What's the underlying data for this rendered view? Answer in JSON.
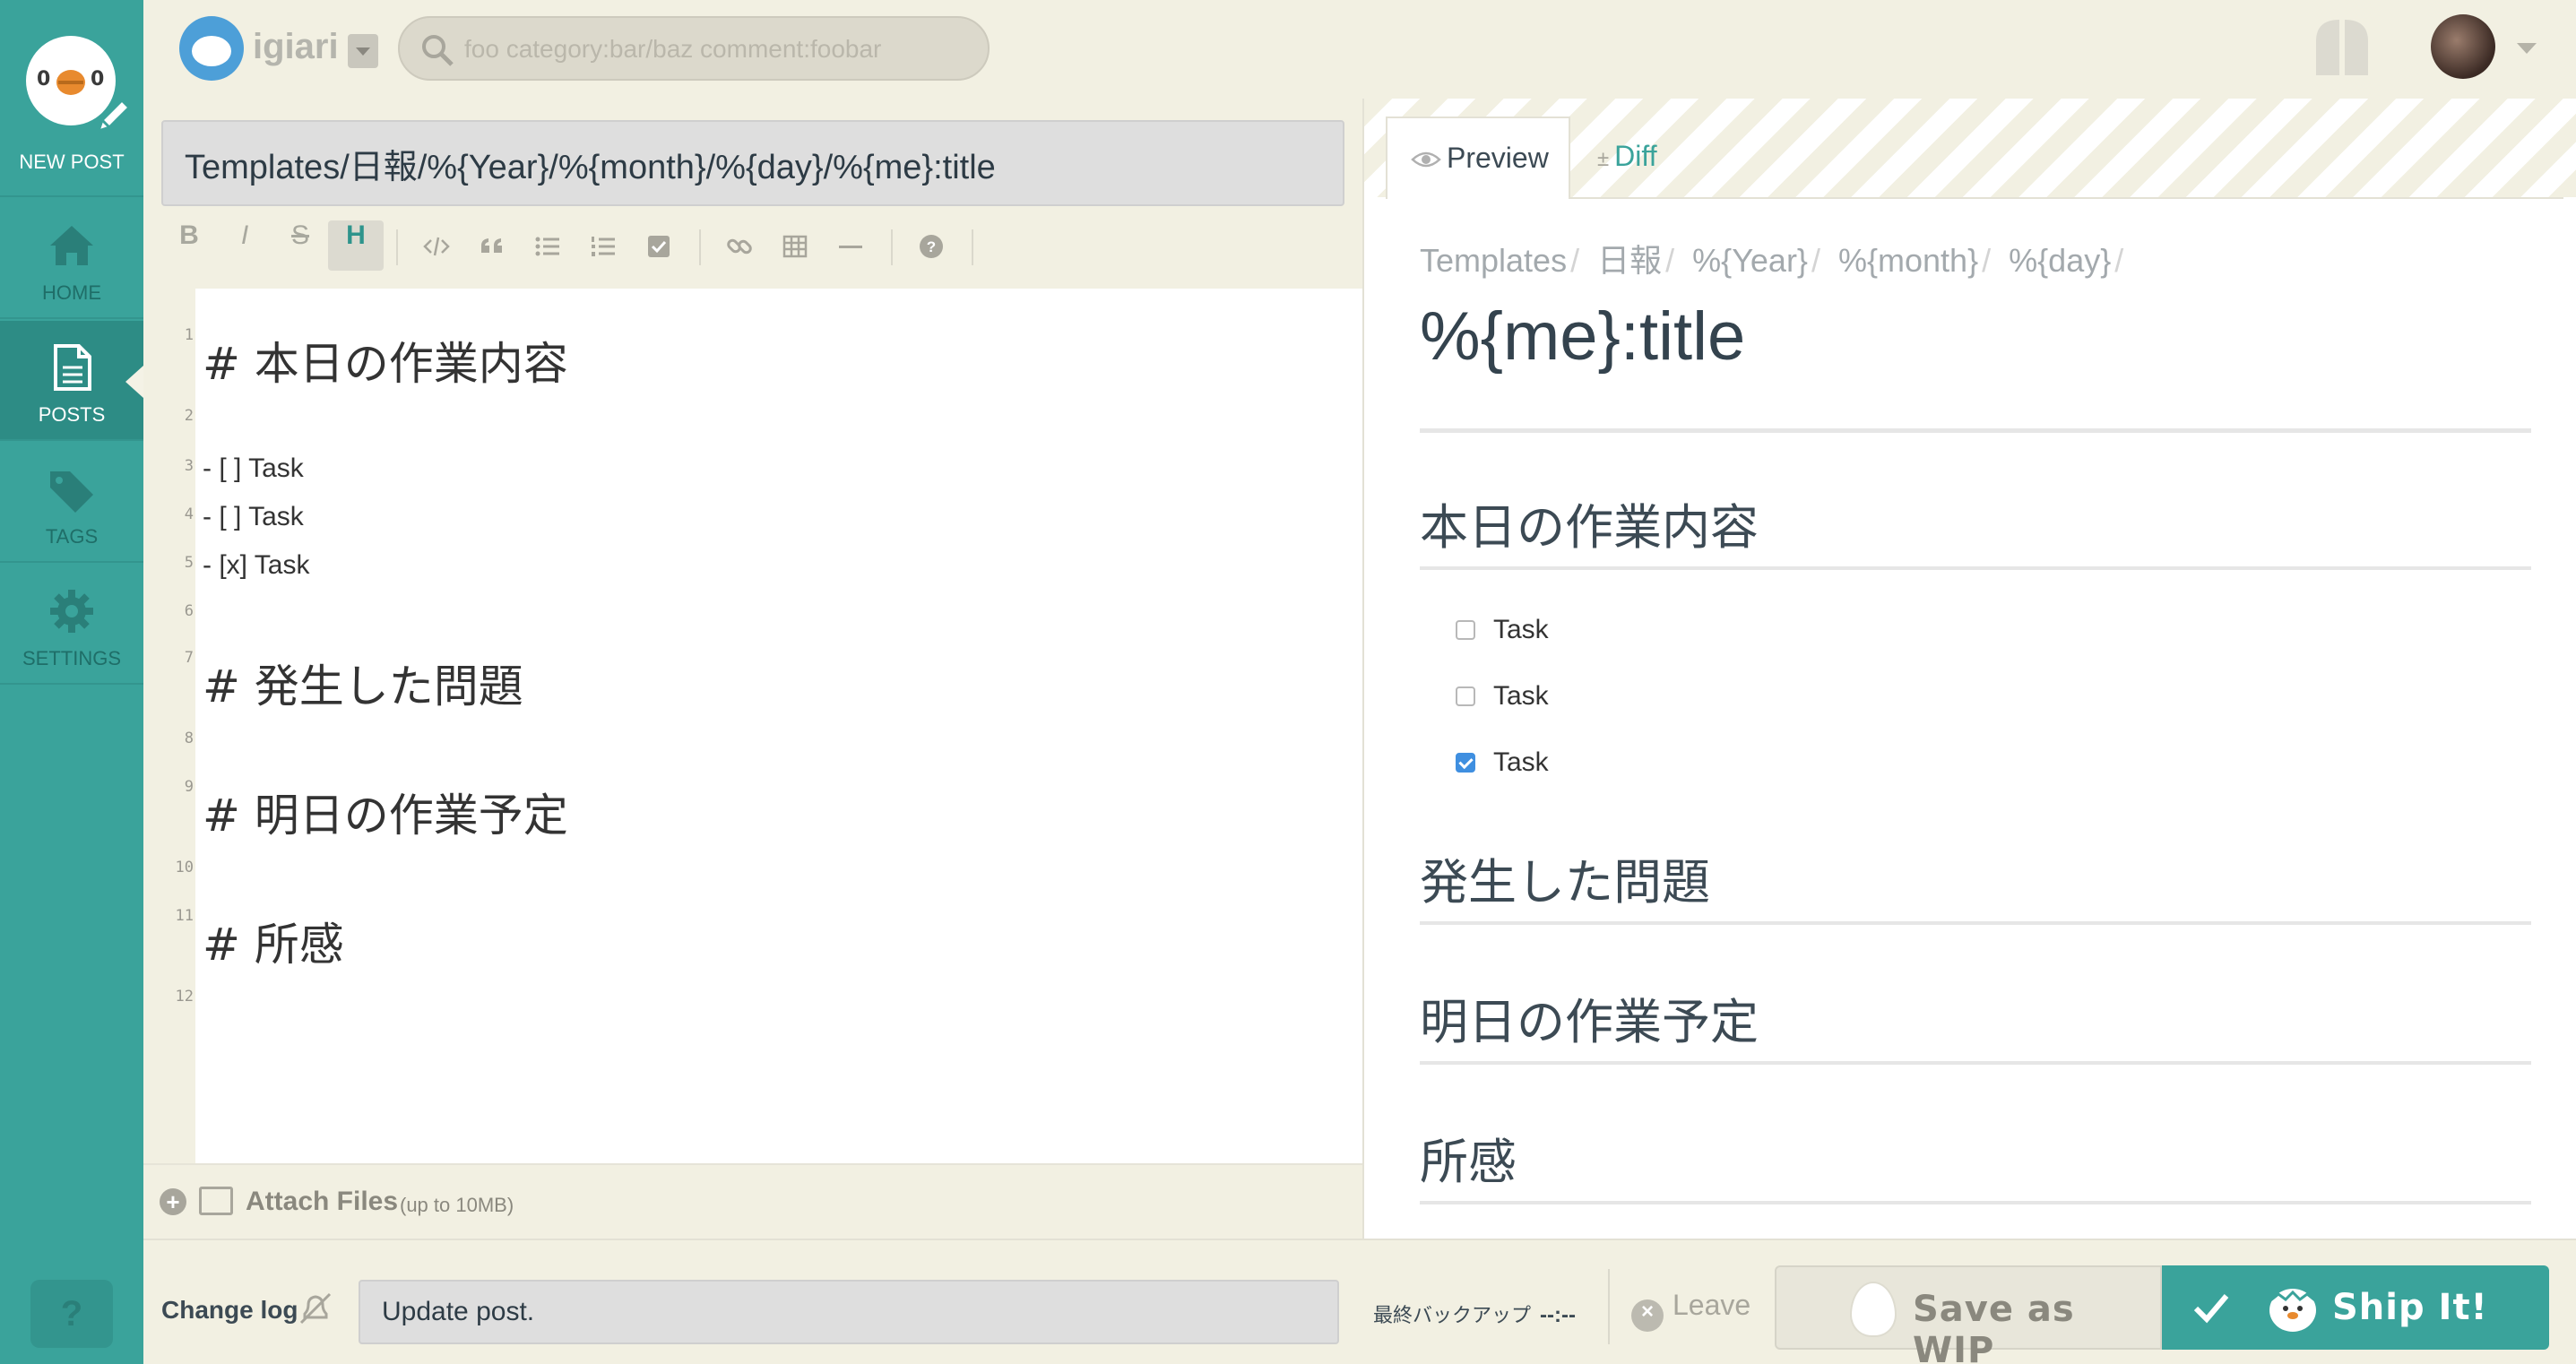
{
  "sidebar": {
    "new_post": "NEW POST",
    "items": [
      {
        "label": "HOME",
        "icon": "home-icon"
      },
      {
        "label": "POSTS",
        "icon": "document-icon",
        "active": true
      },
      {
        "label": "TAGS",
        "icon": "tags-icon"
      },
      {
        "label": "SETTINGS",
        "icon": "gear-icon"
      }
    ],
    "help": "?"
  },
  "topbar": {
    "team_name": "igiari",
    "search_placeholder": "foo category:bar/baz comment:foobar"
  },
  "editor": {
    "title_value": "Templates/日報/%{Year}/%{month}/%{day}/%{me}:title",
    "toolbar": {
      "bold": "B",
      "italic": "I",
      "strike": "S",
      "heading": "H",
      "help": "?"
    },
    "lines": [
      {
        "n": "1",
        "text": "# 本日の作業内容"
      },
      {
        "n": "2",
        "text": ""
      },
      {
        "n": "3",
        "text": "- [ ] Task"
      },
      {
        "n": "4",
        "text": "- [ ] Task"
      },
      {
        "n": "5",
        "text": "- [x] Task"
      },
      {
        "n": "6",
        "text": ""
      },
      {
        "n": "7",
        "text": "# 発生した問題"
      },
      {
        "n": "8",
        "text": ""
      },
      {
        "n": "9",
        "text": "# 明日の作業予定"
      },
      {
        "n": "10",
        "text": ""
      },
      {
        "n": "11",
        "text": "# 所感"
      },
      {
        "n": "12",
        "text": ""
      }
    ],
    "attach_label": "Attach Files",
    "attach_note": "(up to 10MB)"
  },
  "preview": {
    "tab_preview": "Preview",
    "tab_diff_prefix": "±",
    "tab_diff": "Diff",
    "breadcrumbs": [
      "Templates",
      "日報",
      "%{Year}",
      "%{month}",
      "%{day}"
    ],
    "separator": "/",
    "title": "%{me}:title",
    "sections": {
      "s1": "本日の作業内容",
      "s2": "発生した問題",
      "s3": "明日の作業予定",
      "s4": "所感"
    },
    "tasks": [
      {
        "label": "Task",
        "checked": false
      },
      {
        "label": "Task",
        "checked": false
      },
      {
        "label": "Task",
        "checked": true
      }
    ]
  },
  "bottombar": {
    "changelog_label": "Change log",
    "changelog_value": "Update post.",
    "backup_label": "最終バックアップ",
    "backup_time": "--:--",
    "leave_label": "Leave",
    "wip_label": "Save as WIP",
    "ship_label": "Ship It!"
  },
  "colors": {
    "brand": "#3aa39b",
    "background": "#f2f0e2",
    "checkbox_checked": "#3f8fe0"
  }
}
